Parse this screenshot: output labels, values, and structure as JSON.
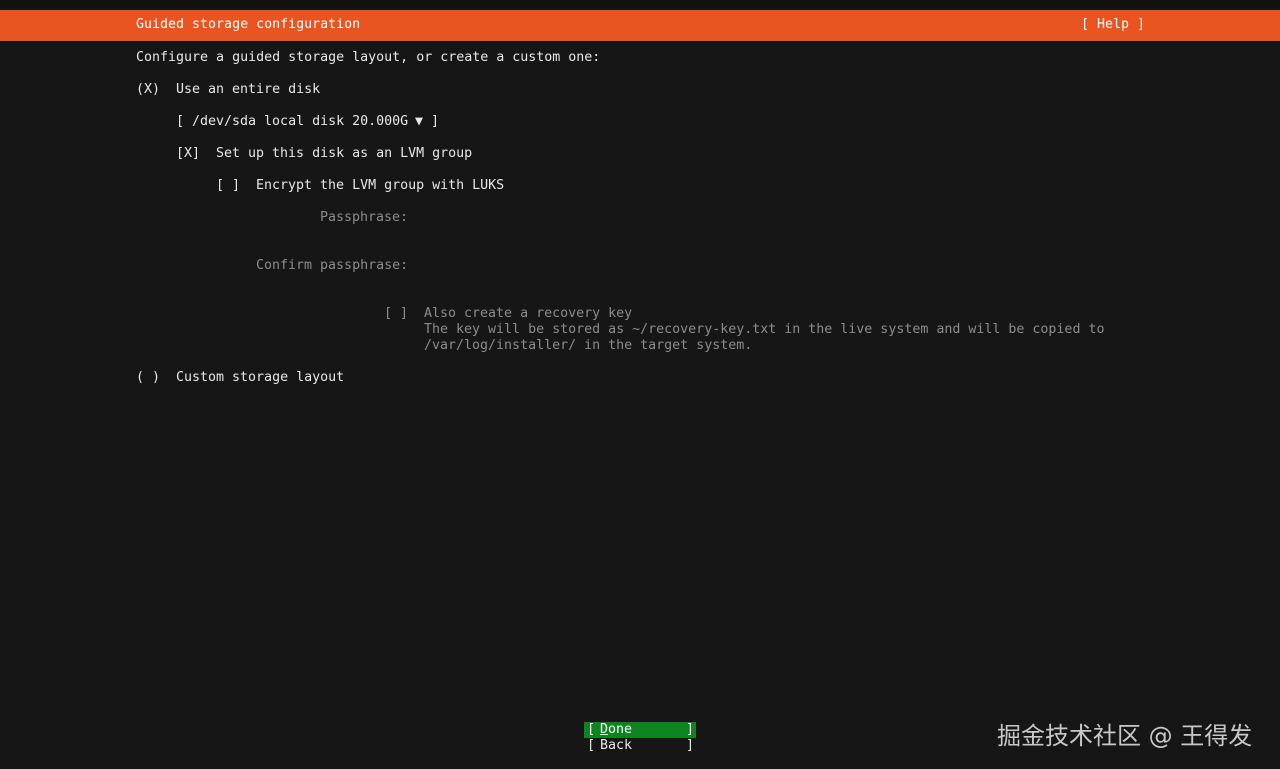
{
  "header": {
    "title": "Guided storage configuration",
    "help": "[ Help ]"
  },
  "intro": "Configure a guided storage layout, or create a custom one:",
  "use_entire_disk": {
    "marker": "(X)",
    "label": "Use an entire disk"
  },
  "disk_select": {
    "open": "[",
    "value": "/dev/sda local disk 20.000G",
    "arrow": "▼",
    "close": "]"
  },
  "lvm": {
    "marker": "[X]",
    "label": "Set up this disk as an LVM group"
  },
  "encrypt": {
    "marker": "[ ]",
    "label": "Encrypt the LVM group with LUKS"
  },
  "passphrase": {
    "label": "Passphrase:",
    "value": ""
  },
  "confirm_passphrase": {
    "label": "Confirm passphrase:",
    "value": ""
  },
  "recovery": {
    "marker": "[ ]",
    "label": "Also create a recovery key",
    "desc_line1": "The key will be stored as ~/recovery-key.txt in the live system and will be copied to",
    "desc_line2": "/var/log/installer/ in the target system."
  },
  "custom_layout": {
    "marker": "( )",
    "label": "Custom storage layout"
  },
  "buttons": {
    "done": {
      "open": "[",
      "first": "D",
      "rest": "one",
      "close": "]"
    },
    "back": {
      "open": "[",
      "label": "Back",
      "close": "]"
    }
  },
  "watermark": "掘金技术社区 @ 王得发",
  "colors": {
    "accent": "#e95420",
    "background": "#161616",
    "done_button": "#0e8420",
    "dim_text": "#8c8c8c"
  }
}
